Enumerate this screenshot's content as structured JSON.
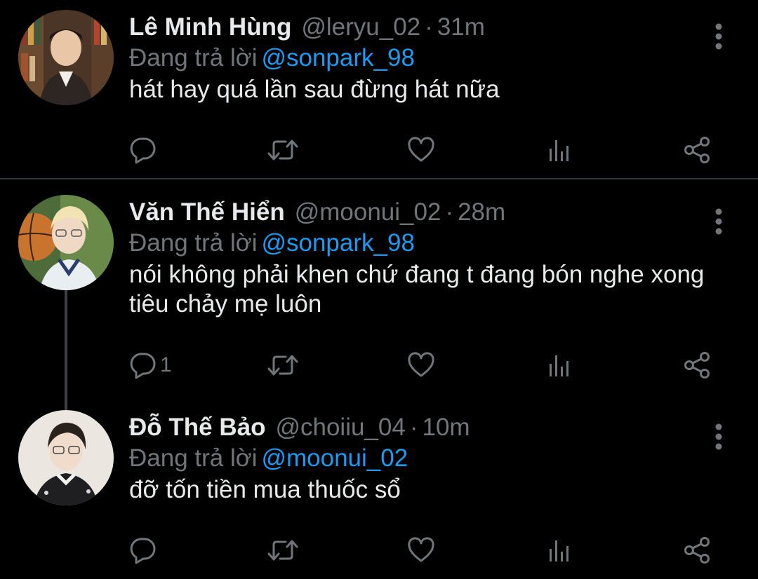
{
  "tweets": [
    {
      "name": "Lê Minh Hùng",
      "handle": "@leryu_02",
      "separator": "·",
      "time": "31m",
      "reply_prefix": "Đang trả lời",
      "reply_to": "@sonpark_98",
      "text": "hát hay quá lần sau đừng hát nữa",
      "reply_count": ""
    },
    {
      "name": "Văn Thế Hiển",
      "handle": "@moonui_02",
      "separator": "·",
      "time": "28m",
      "reply_prefix": "Đang trả lời",
      "reply_to": "@sonpark_98",
      "text": "nói không phải khen chứ đang t đang bón nghe xong tiêu chảy mẹ luôn",
      "reply_count": "1"
    },
    {
      "name": "Đỗ Thế Bảo",
      "handle": "@choiiu_04",
      "separator": "·",
      "time": "10m",
      "reply_prefix": "Đang trả lời",
      "reply_to": "@moonui_02",
      "text": "đỡ tốn tiền mua thuốc sổ",
      "reply_count": ""
    }
  ],
  "icons": {
    "reply": "reply-icon",
    "retweet": "retweet-icon",
    "like": "heart-icon",
    "analytics": "analytics-icon",
    "share": "share-icon",
    "more": "more-vertical-icon"
  },
  "colors": {
    "background": "#000000",
    "text": "#e7e9ea",
    "muted": "#71767b",
    "link": "#1d9bf0",
    "divider": "#2f3336"
  }
}
